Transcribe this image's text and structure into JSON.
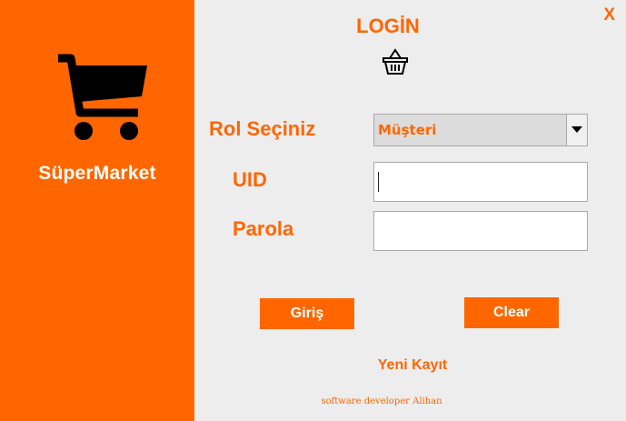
{
  "brand": {
    "name": "SüperMarket",
    "icon": "shopping-cart-icon"
  },
  "window": {
    "close_label": "X"
  },
  "login": {
    "title": "LOGİN",
    "icon": "basket-icon"
  },
  "form": {
    "role_label": "Rol Seçiniz",
    "role_value": "Müşteri",
    "uid_label": "UID",
    "uid_value": "",
    "password_label": "Parola",
    "password_value": ""
  },
  "buttons": {
    "login_label": "Giriş",
    "clear_label": "Clear"
  },
  "register_link": "Yeni Kayıt",
  "footer": {
    "credit": "software developer Alihan"
  },
  "colors": {
    "accent": "#ff6600",
    "background": "#ededed",
    "text_on_accent": "#ffffff"
  }
}
